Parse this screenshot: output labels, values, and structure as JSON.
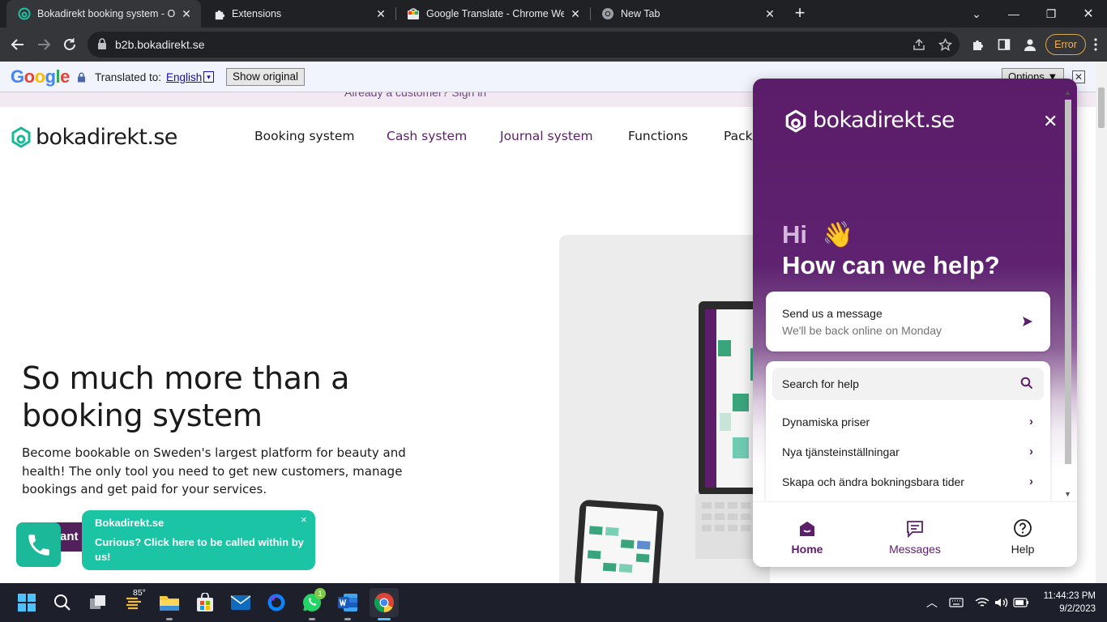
{
  "browser": {
    "tabs": [
      {
        "title": "Bokadirekt booking system - Ove",
        "active": true,
        "favicon": "bokadirekt-icon"
      },
      {
        "title": "Extensions",
        "active": false,
        "favicon": "puzzle-icon"
      },
      {
        "title": "Google Translate - Chrome Web S",
        "active": false,
        "favicon": "chrome-web-store-icon"
      },
      {
        "title": "New Tab",
        "active": false,
        "favicon": "chrome-icon"
      }
    ],
    "url": "b2b.bokadirekt.se",
    "error_label": "Error"
  },
  "translate_bar": {
    "google_logo": "Google",
    "translated_to": "Translated to:",
    "language": "English",
    "lang_arrow": "▾",
    "show_original": "Show original",
    "options": "Options ▼",
    "close": "✕"
  },
  "site": {
    "banner_text": "Already a customer? Sign in",
    "logo_text": "bokadirekt.se",
    "nav": [
      {
        "label": "Booking system",
        "color": "#1a1a1a"
      },
      {
        "label": "Cash system",
        "color": "#5c1e6b"
      },
      {
        "label": "Journal system",
        "color": "#5c1e6b"
      },
      {
        "label": "Functions",
        "color": "#1a1a1a"
      },
      {
        "label": "Pack",
        "color": "#1a1a1a"
      }
    ],
    "hero_title": "So much more than a booking system",
    "hero_subtitle": "Become bookable on Sweden's largest platform for beauty and health! The only tool you need to get new customers, manage bookings and get paid for your services.",
    "hero_cta": "ant"
  },
  "call_widget": {
    "title": "Bokadirekt.se",
    "message": "Curious? Click here to be called within by us!",
    "close": "×"
  },
  "chat": {
    "logo_text": "bokadirekt.se",
    "close": "✕",
    "greeting": "Hi",
    "greeting_emoji": "👋",
    "headline": "How can we help?",
    "send_title": "Send us a message",
    "send_subtitle": "We'll be back online on Monday",
    "search_label": "Search for help",
    "articles": [
      "Dynamiska priser",
      "Nya tjänsteinställningar",
      "Skapa och ändra bokningsbara tider"
    ],
    "footer_tabs": [
      {
        "label": "Home",
        "icon": "home-icon",
        "active": true
      },
      {
        "label": "Messages",
        "icon": "messages-icon",
        "active": false
      },
      {
        "label": "Help",
        "icon": "help-icon",
        "active": false
      }
    ]
  },
  "taskbar": {
    "weather_temp": "85°",
    "whatsapp_badge": "1",
    "time": "11:44:23 PM",
    "date": "9/2/2023"
  },
  "colors": {
    "brand_purple": "#5c1e6b",
    "brand_green": "#1bb89a",
    "chrome_dark": "#202124"
  }
}
